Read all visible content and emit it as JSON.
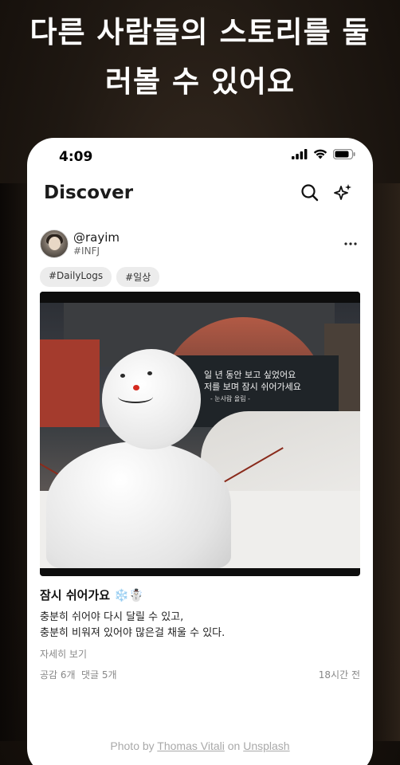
{
  "headline": {
    "line1": "다른 사람들의 스토리를 둘",
    "line2": "러볼 수 있어요"
  },
  "status_bar": {
    "time": "4:09",
    "icons": [
      "signal-icon",
      "wifi-icon",
      "battery-icon"
    ]
  },
  "app_header": {
    "title": "Discover",
    "icons": [
      "search-icon",
      "sparkle-icon"
    ]
  },
  "post": {
    "username": "@rayim",
    "mbti": "#INFJ",
    "more_icon": "more-horizontal-icon",
    "tags": [
      "#DailyLogs",
      "#일상"
    ],
    "image_caption": {
      "line1": "일 년 동안 보고 싶었어요",
      "line2": "저를 보며 잠시 쉬어가세요",
      "line3": "- 눈사람 올림 -"
    },
    "title": "잠시 쉬어가요 ❄️☃️",
    "body": [
      "충분히 쉬어야 다시 달릴 수 있고,",
      "충분히 비워져 있어야 많은걸 채울 수 있다."
    ],
    "read_more": "자세히 보기",
    "likes": "공감 6개",
    "comments": "댓글 5개",
    "time": "18시간 전"
  },
  "credit": {
    "prefix": "Photo by",
    "author": "Thomas Vitali",
    "mid": "on",
    "site": "Unsplash"
  },
  "colors": {
    "background": "#1f1812",
    "card": "#ffffff",
    "tag_bg": "#ececec",
    "muted_text": "#888888"
  }
}
